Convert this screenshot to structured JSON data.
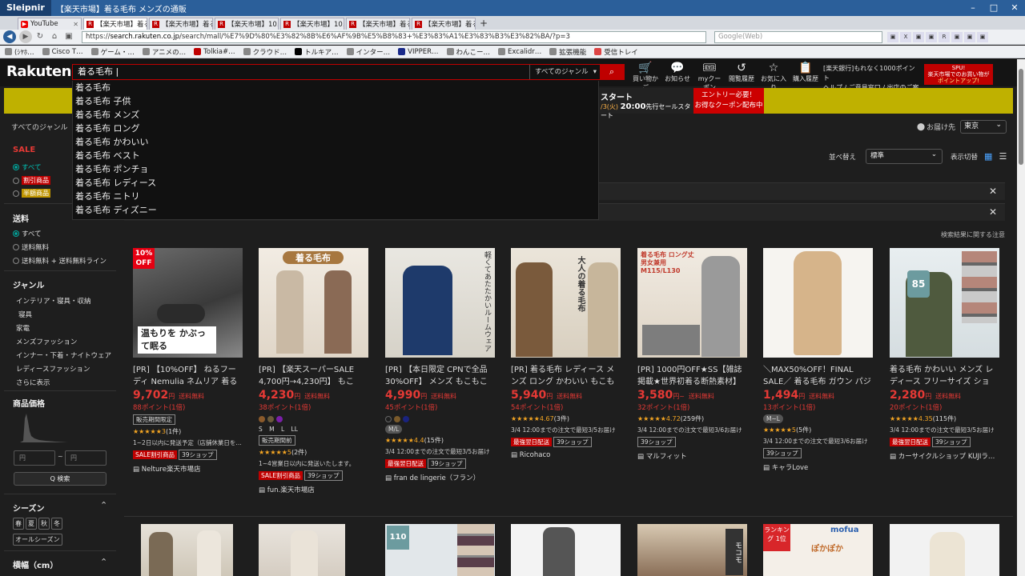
{
  "window": {
    "app": "Sleipnir",
    "title": "【楽天市場】着る毛布 メンズの通販",
    "controls": [
      "–",
      "□",
      "✕"
    ]
  },
  "tabs": [
    {
      "label": "YouTube",
      "type": "yt"
    },
    {
      "label": "【楽天市場】着る…",
      "type": "r"
    },
    {
      "label": "【楽天市場】着る…",
      "type": "r"
    },
    {
      "label": "【楽天市場】10…",
      "type": "r"
    },
    {
      "label": "【楽天市場】10…",
      "type": "r"
    },
    {
      "label": "【楽天市場】着る…",
      "type": "r"
    },
    {
      "label": "【楽天市場】着る…",
      "type": "r"
    }
  ],
  "address": {
    "url_prefix": "https://",
    "url_host": "search.rakuten.co.jp",
    "url_path": "/search/mall/%E7%9D%80%E3%82%8B%E6%AF%9B%E5%B8%83+%E3%83%A1%E3%83%B3%E3%82%BA/?p=3",
    "search_placeholder": "Google(Web)"
  },
  "bookmarks": [
    "(ｼﾔﾎ…",
    "Cisco T…",
    "ゲーム・…",
    "アニメの…",
    "Tolkia#…",
    "クラウド…",
    "トルキア…",
    "インター…",
    "VIPPER…",
    "わんこー…",
    "Excalidr…",
    "拡張機能",
    "受信トレイ"
  ],
  "rakuten": {
    "logo": "Rakuten",
    "search_value": "着る毛布 |",
    "genre": "すべてのジャンル",
    "header_icons": [
      {
        "glyph": "🛒",
        "label": "買い物かご"
      },
      {
        "glyph": "💬",
        "label": "お知らせ"
      },
      {
        "glyph": "🎟",
        "label": "myクーポン"
      },
      {
        "glyph": "↺",
        "label": "閲覧履歴"
      },
      {
        "glyph": "☆",
        "label": "お気に入り"
      },
      {
        "glyph": "📋",
        "label": "購入履歴"
      }
    ],
    "help_top": "[楽天銀行]もれなく1000ポイント",
    "help_bottom": "ヘルプ / ご意見窓口 / 出店のご案内",
    "promo_lines": [
      "SPU!",
      "楽天市場でのお買い物が",
      "ポイントアップ!"
    ]
  },
  "banner": {
    "line1": "スタート",
    "line2_pre": "/3(火) ",
    "line2_time": "20:00",
    "line2_post": "先行セールスタート",
    "entry1": "エントリー必要！",
    "entry2": "お得なクーポン配布中"
  },
  "suggestions": [
    "着る毛布",
    "着る毛布 子供",
    "着る毛布 メンズ",
    "着る毛布 ロング",
    "着る毛布 かわいい",
    "着る毛布 ベスト",
    "着る毛布 ポンチョ",
    "着る毛布 レディース",
    "着る毛布 ニトリ",
    "着る毛布 ディズニー"
  ],
  "breadcrumb": "すべてのジャンル",
  "delivery": {
    "label": "お届け先",
    "value": "東京"
  },
  "sidebar": {
    "sale_title": "SALE",
    "sale_opts": [
      "すべて",
      "割引商品",
      "半額商品"
    ],
    "ship_title": "送料",
    "ship_opts": [
      "すべて",
      "送料無料",
      "送料無料 + 送料無料ライン"
    ],
    "genre_title": "ジャンル",
    "genre_parent": "インテリア・寝具・収納",
    "genres": [
      "寝具",
      "家電",
      "メンズファッション",
      "インナー・下着・ナイトウェア",
      "レディースファッション",
      "さらに表示"
    ],
    "price_title": "商品価格",
    "price_min": "円",
    "price_sep": "~",
    "price_max": "円",
    "price_btn": "Q 検索",
    "season_title": "シーズン",
    "seasons": [
      "春",
      "夏",
      "秋",
      "冬"
    ],
    "season_all": "オールシーズン",
    "width_title": "横幅（cm）"
  },
  "sort": {
    "label": "並べ替え",
    "value": "標準",
    "view_label": "表示切替"
  },
  "results_note": "検索結果に関する注意",
  "products": [
    {
      "img_text": "温もりを かぶって眠る",
      "pct": "10%",
      "title": "[PR] 【10%OFF】 ねるフーディ Nemulia ネムリア 着る毛…",
      "price": "9,702",
      "unit": "円",
      "ship": "送料無料",
      "points": "88ポイント(1倍)",
      "tags": [
        "販売期間限定"
      ],
      "rating": "★★★★★3",
      "reviews": "(1件)",
      "note": "1~2日以内に発送予定（店舗休業日を…",
      "tags2": [
        "SALE割引商品"
      ],
      "tag_plain": "39ショップ",
      "shop": "Nelture楽天市場店"
    },
    {
      "img_text": "着る毛布",
      "pct": "",
      "title": "[PR] 【楽天スーパーSALE 4,700円→4,230円】 もこも…",
      "price": "4,230",
      "unit": "円",
      "ship": "送料無料",
      "points": "38ポイント(1倍)",
      "sizes": "S M L LL",
      "tags": [
        "販売期間前"
      ],
      "rating": "★★★★★5",
      "reviews": "(2件)",
      "note": "1~4営業日以内に発送いたします。",
      "tags2": [
        "SALE割引商品"
      ],
      "tag_plain": "39ショップ",
      "shop": "fun.楽天市場店"
    },
    {
      "img_text": "軽くてあたたかいルームウェア",
      "pct": "",
      "title": "[PR] 【本日限定 CPNで全品30%OFF】 メンズ もこもこ …",
      "price": "4,990",
      "unit": "円",
      "ship": "送料無料",
      "points": "45ポイント(1倍)",
      "badge": "M/L",
      "rating": "★★★★★4.4",
      "reviews": "(15件)",
      "note": "3/4 12:00までの注文で最短3/5お届け",
      "tags2": [
        "最強翌日配送"
      ],
      "tag_plain": "39ショップ",
      "shop": "fran de lingerie（フラン）"
    },
    {
      "img_text": "大人の着る毛布",
      "pct": "",
      "title": "[PR] 着る毛布 レディース メンズ ロング かわいい もこもこ…",
      "price": "5,940",
      "unit": "円",
      "ship": "送料無料",
      "points": "54ポイント(1倍)",
      "rating": "★★★★★4.67",
      "reviews": "(3件)",
      "note": "3/4 12:00までの注文で最短3/5お届け",
      "tags2": [
        "最強翌日配送"
      ],
      "tag_plain": "39ショップ",
      "shop": "Ricohaco"
    },
    {
      "img_text": "着る毛布 ロング丈 男女兼用 M115/L130",
      "pct": "",
      "title": "[PR] 1000円OFF★SS【雑誌掲載★世界初着る断熱素材】 着る…",
      "price": "3,580",
      "unit": "円~",
      "ship": "送料無料",
      "points": "32ポイント(1倍)",
      "rating": "★★★★★4.72",
      "reviews": "(259件)",
      "note": "3/4 12:00までの注文で最短3/6お届け",
      "tag_plain": "39ショップ",
      "shop": "マルフィット"
    },
    {
      "img_text": "",
      "pct": "",
      "title": "＼MAX50%OFF！FINAL SALE／ 着る毛布 ガウン パジャマ …",
      "price": "1,494",
      "unit": "円",
      "ship": "送料無料",
      "points": "13ポイント(1倍)",
      "badge": "M~L",
      "rating": "★★★★★5",
      "reviews": "(5件)",
      "note": "3/4 12:00までの注文で最短3/6お届け",
      "tag_plain": "39ショップ",
      "shop": "キャラLove"
    },
    {
      "img_text": "85",
      "pct": "",
      "title": "着る毛布 かわいい メンズ レディース フリーサイズ ショー…",
      "price": "2,280",
      "unit": "円",
      "ship": "送料無料",
      "points": "20ポイント(1倍)",
      "rating": "★★★★★4.35",
      "reviews": "(115件)",
      "note": "3/4 12:00までの注文で最短3/5お届け",
      "tags2": [
        "最強翌日配送"
      ],
      "tag_plain": "39ショップ",
      "shop": "カーサイクルショップ KUJIラ…"
    }
  ],
  "row2_texts": [
    "110",
    "mofua",
    "ランキング 1位",
    "ぽかぽか"
  ],
  "colors": {
    "accent": "#bf0000",
    "price": "#e53935",
    "star": "#f5a623",
    "teal": "#00aaa0"
  }
}
